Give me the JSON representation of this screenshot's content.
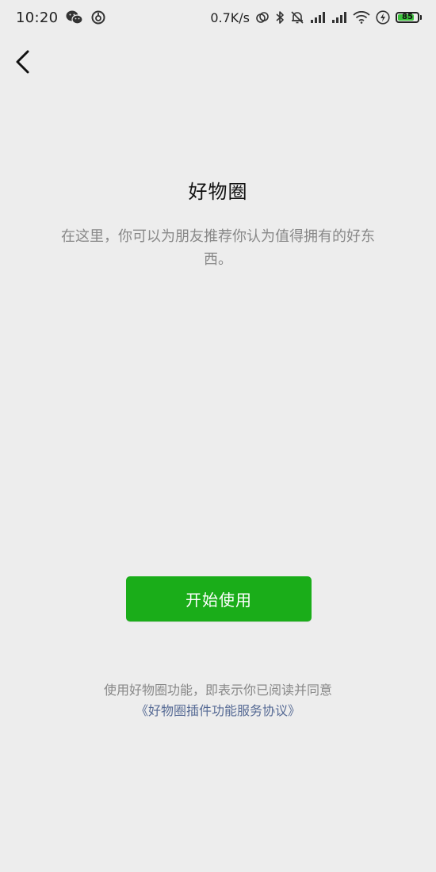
{
  "status_bar": {
    "time": "10:20",
    "network_speed": "0.7K/s",
    "battery_level": "85",
    "battery_fraction": 0.85,
    "battery_color": "#3cc13c",
    "left_icons": [
      "wechat-icon",
      "netease-music-icon"
    ],
    "right_icons": [
      "hotspot-icon",
      "bluetooth-icon",
      "mute-bell-icon",
      "signal-icon",
      "signal-icon",
      "wifi-icon",
      "charging-icon",
      "battery-icon"
    ]
  },
  "nav": {
    "back_icon": "chevron-left-icon"
  },
  "main": {
    "title": "好物圈",
    "description": "在这里，你可以为朋友推荐你认为值得拥有的好东西。",
    "start_button": "开始使用",
    "start_button_color": "#1aad19"
  },
  "agreement": {
    "text": "使用好物圈功能，即表示你已阅读并同意",
    "link": "《好物圈插件功能服务协议》",
    "link_color": "#576b95"
  }
}
